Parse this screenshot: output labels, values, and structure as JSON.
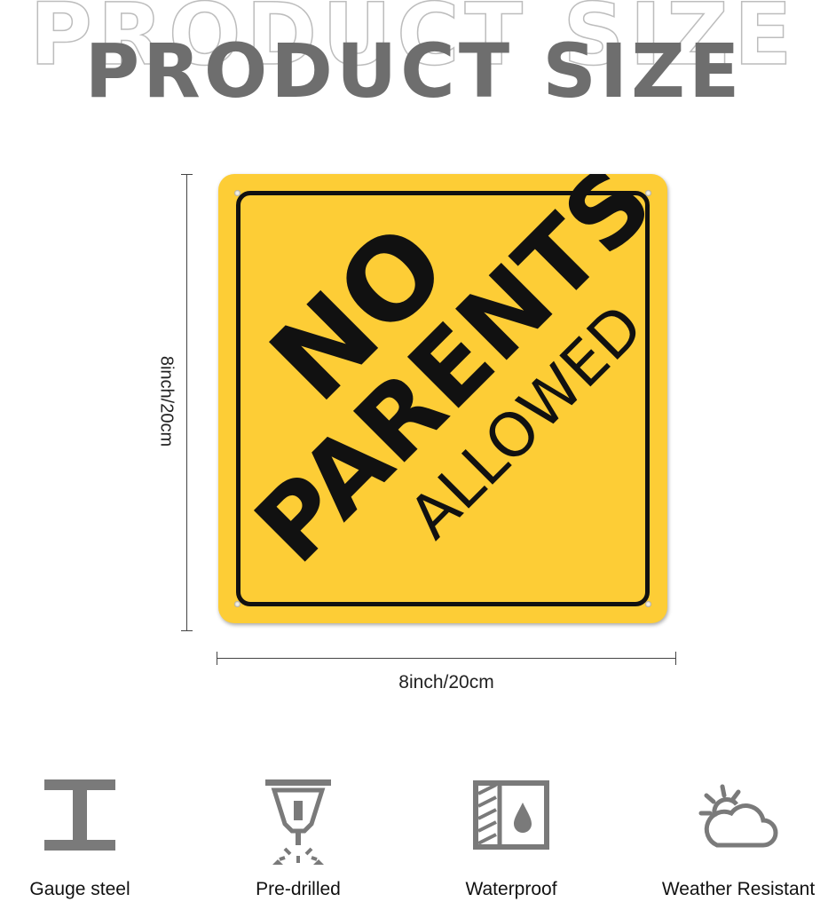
{
  "header": {
    "title": "PRODUCT SIZE",
    "background_title": "PRODUCT SIZE"
  },
  "dimensions": {
    "height_label": "8inch/20cm",
    "width_label": "8inch/20cm"
  },
  "sign": {
    "line1": "NO",
    "line2": "PARENTS",
    "line3": "ALLOWED",
    "background_color": "#fdcd36",
    "text_color": "#111111"
  },
  "features": [
    {
      "label": "Gauge steel",
      "icon": "steel-beam-icon"
    },
    {
      "label": "Pre-drilled",
      "icon": "drill-icon"
    },
    {
      "label": "Waterproof",
      "icon": "waterproof-icon"
    },
    {
      "label": "Weather Resistant",
      "icon": "weather-icon"
    }
  ],
  "colors": {
    "title": "#6e6e6e",
    "icon": "#7a7a7a"
  }
}
